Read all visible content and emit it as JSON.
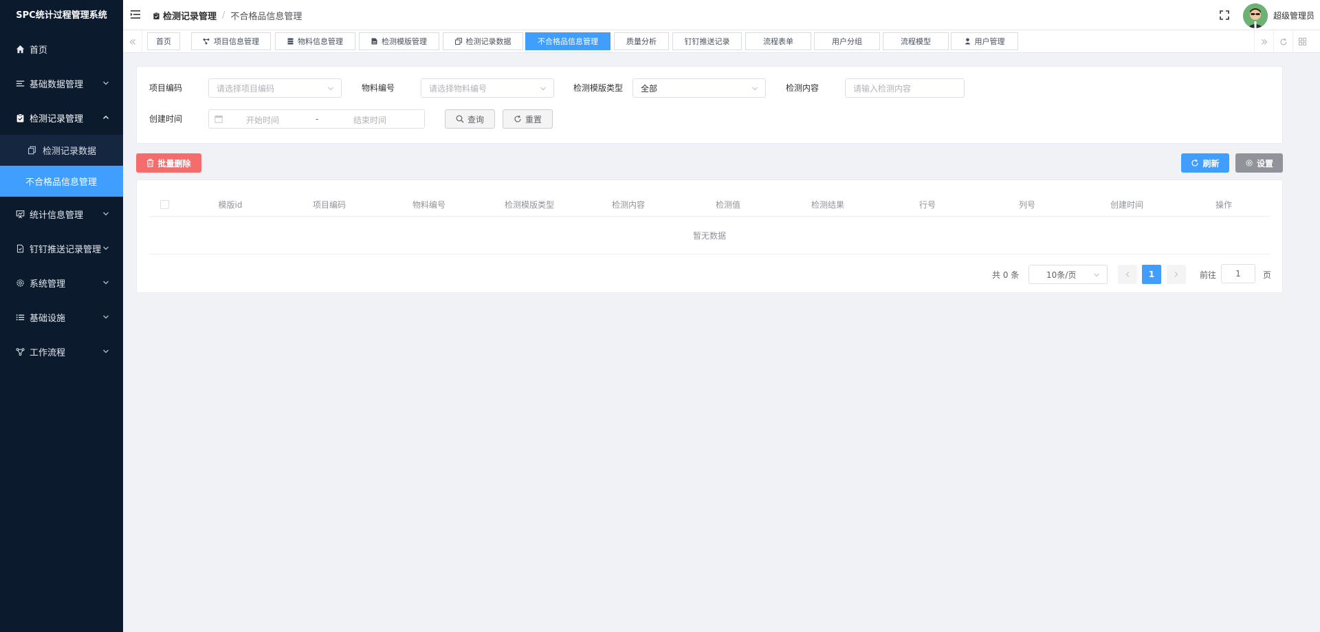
{
  "app": {
    "title": "SPC统计过程管理系统"
  },
  "sidebar": {
    "items": [
      {
        "label": "首页",
        "icon": "home-icon"
      },
      {
        "label": "基础数据管理",
        "icon": "list-icon"
      },
      {
        "label": "检测记录管理",
        "icon": "clipboard-icon",
        "expanded": true,
        "children": [
          {
            "label": "检测记录数据",
            "icon": "copy-icon"
          },
          {
            "label": "不合格品信息管理",
            "active": true
          }
        ]
      },
      {
        "label": "统计信息管理",
        "icon": "chart-board-icon"
      },
      {
        "label": "钉钉推送记录管理",
        "icon": "document-icon"
      },
      {
        "label": "系统管理",
        "icon": "gear-icon"
      },
      {
        "label": "基础设施",
        "icon": "bullet-list-icon"
      },
      {
        "label": "工作流程",
        "icon": "flow-icon"
      }
    ]
  },
  "header": {
    "breadcrumb": [
      "检测记录管理",
      "不合格品信息管理"
    ],
    "username": "超级管理员"
  },
  "tags": [
    {
      "label": "首页"
    },
    {
      "label": "项目信息管理",
      "icon": "share-icon"
    },
    {
      "label": "物料信息管理",
      "icon": "database-icon"
    },
    {
      "label": "检测模版管理",
      "icon": "file-icon"
    },
    {
      "label": "检测记录数据",
      "icon": "copy-icon"
    },
    {
      "label": "不合格品信息管理",
      "active": true
    },
    {
      "label": "质量分析"
    },
    {
      "label": "钉钉推送记录"
    },
    {
      "label": "流程表单"
    },
    {
      "label": "用户分组"
    },
    {
      "label": "流程模型"
    },
    {
      "label": "用户管理",
      "icon": "user-icon"
    }
  ],
  "search": {
    "project_code": {
      "label": "项目编码",
      "placeholder": "请选择项目编码"
    },
    "material_code": {
      "label": "物料编号",
      "placeholder": "请选择物料编号"
    },
    "template_type": {
      "label": "检测模版类型",
      "value": "全部"
    },
    "content": {
      "label": "检测内容",
      "placeholder": "请输入检测内容"
    },
    "created": {
      "label": "创建时间",
      "start_placeholder": "开始时间",
      "separator": "-",
      "end_placeholder": "结束时间"
    },
    "query_label": "查询",
    "reset_label": "重置"
  },
  "toolbar": {
    "batch_delete_label": "批量删除",
    "refresh_label": "刷新",
    "settings_label": "设置"
  },
  "table": {
    "columns": [
      "模版id",
      "项目编码",
      "物料编号",
      "检测模版类型",
      "检测内容",
      "检测值",
      "检测结果",
      "行号",
      "列号",
      "创建时间",
      "操作"
    ],
    "rows": [],
    "empty_text": "暂无数据"
  },
  "pagination": {
    "total_text": "共 0 条",
    "page_size": "10条/页",
    "current_page": "1",
    "goto_label": "前往",
    "goto_value": "1",
    "page_suffix": "页"
  },
  "colors": {
    "sidebar_bg": "#0c1a2e",
    "accent": "#409eff",
    "danger": "#f56c6c",
    "info": "#909399"
  }
}
